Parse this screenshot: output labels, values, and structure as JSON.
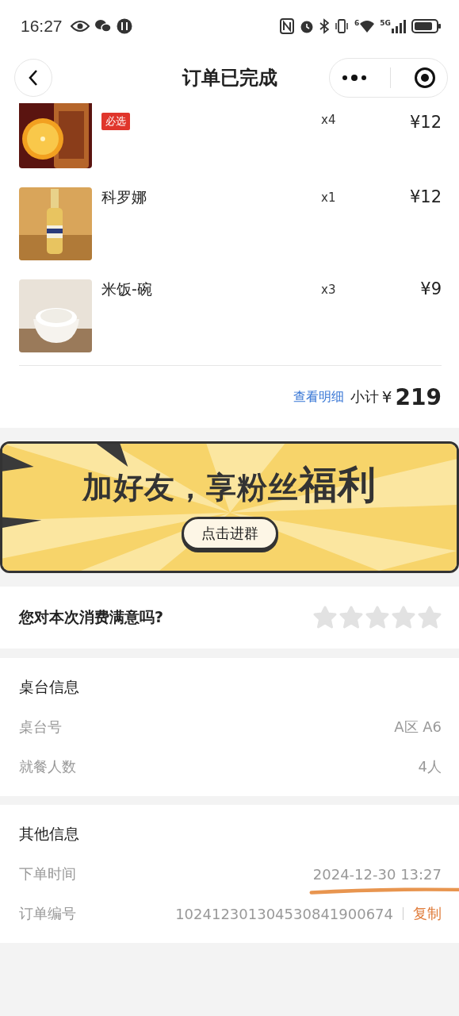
{
  "status_bar": {
    "time": "16:27",
    "network": "5G",
    "wifi_sup": "6"
  },
  "nav": {
    "title": "订单已完成"
  },
  "items": [
    {
      "tag": "必选",
      "qty": "x4",
      "price": "¥12"
    },
    {
      "name": "科罗娜",
      "qty": "x1",
      "price": "¥12"
    },
    {
      "name": "米饭-碗",
      "qty": "x3",
      "price": "¥9"
    }
  ],
  "subtotal": {
    "link": "查看明细",
    "label": "小计",
    "currency": "¥",
    "amount": "219"
  },
  "banner": {
    "headline": "加好友，享粉丝",
    "highlight": "福利",
    "button": "点击进群"
  },
  "rating": {
    "question": "您对本次消费满意吗?",
    "stars": 0
  },
  "sections": [
    {
      "title": "桌台信息",
      "rows": [
        {
          "label": "桌台号",
          "value": "A区 A6"
        },
        {
          "label": "就餐人数",
          "value": "4人"
        }
      ]
    },
    {
      "title": "其他信息",
      "rows": [
        {
          "label": "下单时间",
          "value": "2024-12-30 13:27",
          "underlined": true
        },
        {
          "label": "订单编号",
          "value": "102412301304530841900674",
          "action": "复制"
        }
      ]
    }
  ]
}
